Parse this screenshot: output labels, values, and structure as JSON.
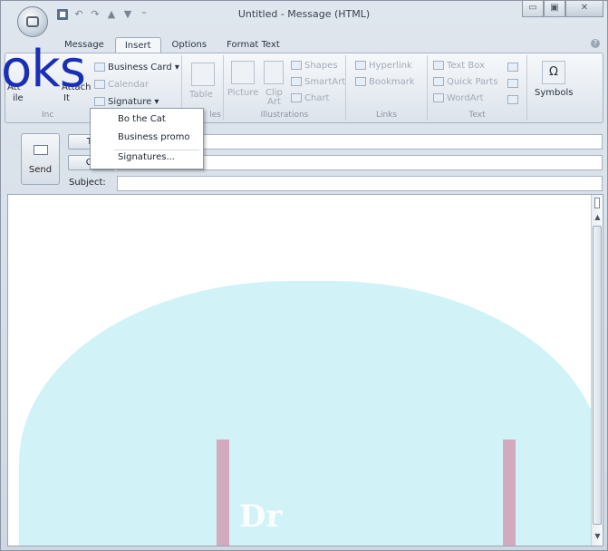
{
  "window": {
    "title": "Untitled - Message (HTML)"
  },
  "quick_access": {
    "icons": [
      "save-icon",
      "undo-icon",
      "redo-icon",
      "previous-icon",
      "next-icon",
      "customize-icon"
    ]
  },
  "window_controls": {
    "minimize": "▭",
    "maximize": "▣",
    "close": "✕"
  },
  "tabs": [
    {
      "label": "Message"
    },
    {
      "label": "Insert"
    },
    {
      "label": "Options"
    },
    {
      "label": "Format Text"
    }
  ],
  "ghost_text": "oks",
  "ribbon": {
    "include": {
      "label": "Inc",
      "attach_file": "Att",
      "attach_file_2": "ile",
      "attach_item": "Attach",
      "attach_item_2": "It",
      "business_card": "Business Card ▾",
      "calendar": "Calendar",
      "signature": "Signature ▾"
    },
    "tables": {
      "table": "Table",
      "label": "les"
    },
    "illustrations": {
      "picture": "Picture",
      "clip_art": "Clip",
      "clip_art_2": "Art",
      "shapes": "Shapes",
      "smartart": "SmartArt",
      "chart": "Chart",
      "label": "Illustrations"
    },
    "links": {
      "hyperlink": "Hyperlink",
      "bookmark": "Bookmark",
      "label": "Links"
    },
    "text": {
      "text_box": "Text Box",
      "quick_parts": "Quick Parts",
      "wordart": "WordArt",
      "label": "Text"
    },
    "symbols": {
      "symbol_glyph": "Ω",
      "label": "Symbols"
    }
  },
  "signature_menu": [
    {
      "label": "Bo the Cat"
    },
    {
      "label": "Business promo"
    },
    {
      "label": "Signatures..."
    }
  ],
  "message": {
    "send_label": "Send",
    "to_label": "To",
    "cc_label": "Cc",
    "subject_label": "Subject:",
    "to_value": "",
    "cc_value": "",
    "subject_value": ""
  },
  "watermark": {
    "text": "DropBooks",
    "visible_text": "Dr"
  }
}
